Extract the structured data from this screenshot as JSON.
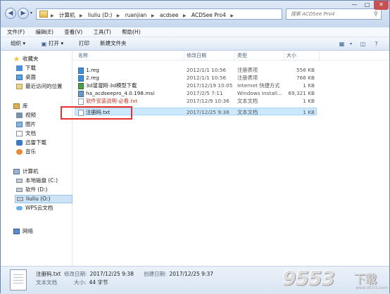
{
  "address": {
    "crumbs": [
      "计算机",
      "liuliu (D:)",
      "ruanjian",
      "acdsee",
      "ACDSee Pro4"
    ],
    "search_placeholder": "搜索 ACDSee Pro4"
  },
  "menu": [
    "文件(F)",
    "编辑(E)",
    "查看(V)",
    "工具(T)",
    "帮助(H)"
  ],
  "toolbar": {
    "organize": "组织 ▾",
    "open": "打开 ▾",
    "print": "打印",
    "new_folder": "新建文件夹"
  },
  "nav": {
    "favorites": "收藏夹",
    "downloads": "下载",
    "desktop": "桌面",
    "recent": "最近访问的位置",
    "libraries": "库",
    "videos": "视频",
    "pictures": "图片",
    "documents": "文档",
    "thunder": "迅雷下载",
    "music": "音乐",
    "computer": "计算机",
    "local_c": "本地磁盘 (C:)",
    "soft_d": "软件 (D:)",
    "liuliu_o": "liuliu (O:)",
    "wps": "WPS云文档",
    "network": "网络"
  },
  "columns": {
    "name": "名称",
    "date": "修改日期",
    "type": "类型",
    "size": "大小"
  },
  "files": [
    {
      "name": "1.reg",
      "date": "2012/1/1 10:56",
      "type": "注册表项",
      "size": "556 KB"
    },
    {
      "name": "2.reg",
      "date": "2012/1/1 10:56",
      "type": "注册表项",
      "size": "766 KB"
    },
    {
      "name": "3d溜溜网-3d模型下载",
      "date": "2017/12/19 10:05",
      "type": "Internet 快捷方式",
      "size": "1 KB"
    },
    {
      "name": "ha_acdseepro_4.0.198.msi",
      "date": "2017/2/5 7:11",
      "type": "Windows Install...",
      "size": "69,321 KB"
    },
    {
      "name": "软件安装说明-必看.txt",
      "date": "2017/12/9 10:36",
      "type": "文本文档",
      "size": "1 KB"
    },
    {
      "name": "注册码.txt",
      "date": "2017/12/25 9:38",
      "type": "文本文档",
      "size": "1 KB"
    }
  ],
  "details": {
    "name": "注册码.txt",
    "kind": "文本文档",
    "modified_label": "修改日期:",
    "modified": "2017/12/25 9:38",
    "created_label": "创建日期:",
    "created": "2017/12/25 9:37",
    "size_label": "大小:",
    "size": "44 字节"
  },
  "watermark": {
    "num": "9553",
    "cn": "下载",
    "url": "www.9553.com"
  }
}
